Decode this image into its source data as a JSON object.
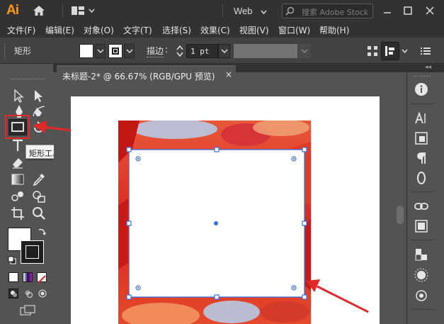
{
  "app": {
    "logo": "Ai",
    "workspace": "Web"
  },
  "search": {
    "placeholder": "搜索 Adobe Stock"
  },
  "menu": [
    "文件(F)",
    "编辑(E)",
    "对象(O)",
    "文字(T)",
    "选择(S)",
    "效果(C)",
    "视图(V)",
    "窗口(W)",
    "帮助(H)"
  ],
  "control": {
    "object_name": "矩形",
    "stroke_label": "描边",
    "stroke_weight": "1 pt",
    "fill_color": "#ffffff"
  },
  "document": {
    "tab_title": "未标题-2* @ 66.67% (RGB/GPU 预览)",
    "close_glyph": "×"
  },
  "tooltip": {
    "text": "矩形工具 (M)"
  },
  "tools": [
    "selection-tool",
    "direct-selection-tool",
    "pen-tool",
    "curvature-tool",
    "rectangle-tool",
    "rotate-tool",
    "type-tool",
    "eraser-tool",
    "gradient-tool",
    "eyedropper-tool",
    "blend-tool",
    "shape-builder-tool",
    "artboard-tool",
    "zoom-tool"
  ],
  "right_panel_icons": [
    "properties-icon",
    "character-icon",
    "transform-icon",
    "paragraph-icon",
    "opentype-icon",
    "links-icon",
    "layers-icon",
    "swatches-icon",
    "symbols-icon",
    "brushes-icon"
  ],
  "colors": {
    "accent_red": "#e02a2a",
    "selection_blue": "#3d6fe0",
    "ui_dark": "#323232",
    "ui_mid": "#535353",
    "logo_orange": "#ff9a00"
  }
}
